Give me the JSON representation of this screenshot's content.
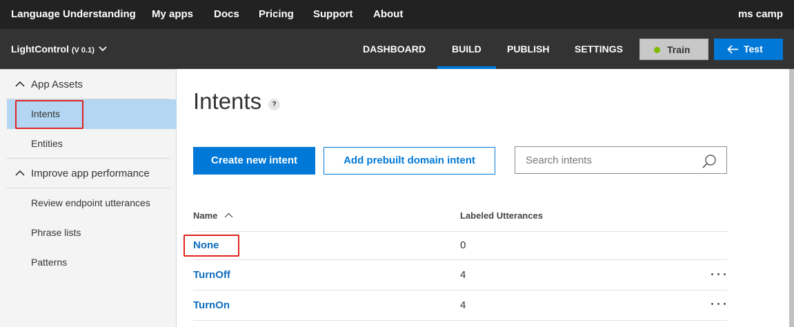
{
  "topnav": {
    "brand": "Language Understanding",
    "links": [
      "My apps",
      "Docs",
      "Pricing",
      "Support",
      "About"
    ],
    "user": "ms camp"
  },
  "appbar": {
    "app_name": "LightControl",
    "version": "(V 0.1)",
    "tabs": [
      "DASHBOARD",
      "BUILD",
      "PUBLISH",
      "SETTINGS"
    ],
    "active_tab": "BUILD",
    "train_label": "Train",
    "test_label": "Test"
  },
  "sidebar": {
    "sections": [
      {
        "title": "App Assets",
        "items": [
          "Intents",
          "Entities"
        ]
      },
      {
        "title": "Improve app performance",
        "items": [
          "Review endpoint utterances",
          "Phrase lists",
          "Patterns"
        ]
      }
    ],
    "active_item": "Intents"
  },
  "main": {
    "title": "Intents",
    "help": "?",
    "create_label": "Create new intent",
    "prebuilt_label": "Add prebuilt domain intent",
    "search_placeholder": "Search intents",
    "columns": {
      "name": "Name",
      "utterances": "Labeled Utterances"
    },
    "rows": [
      {
        "name": "None",
        "count": "0"
      },
      {
        "name": "TurnOff",
        "count": "4"
      },
      {
        "name": "TurnOn",
        "count": "4"
      }
    ]
  },
  "colors": {
    "topnav_bg": "#222222",
    "appbar_bg": "#333333",
    "accent": "#0078d7",
    "train_dot": "#7fba00",
    "active_item_bg": "#b3d7f2",
    "highlight_box": "#e0211d"
  }
}
